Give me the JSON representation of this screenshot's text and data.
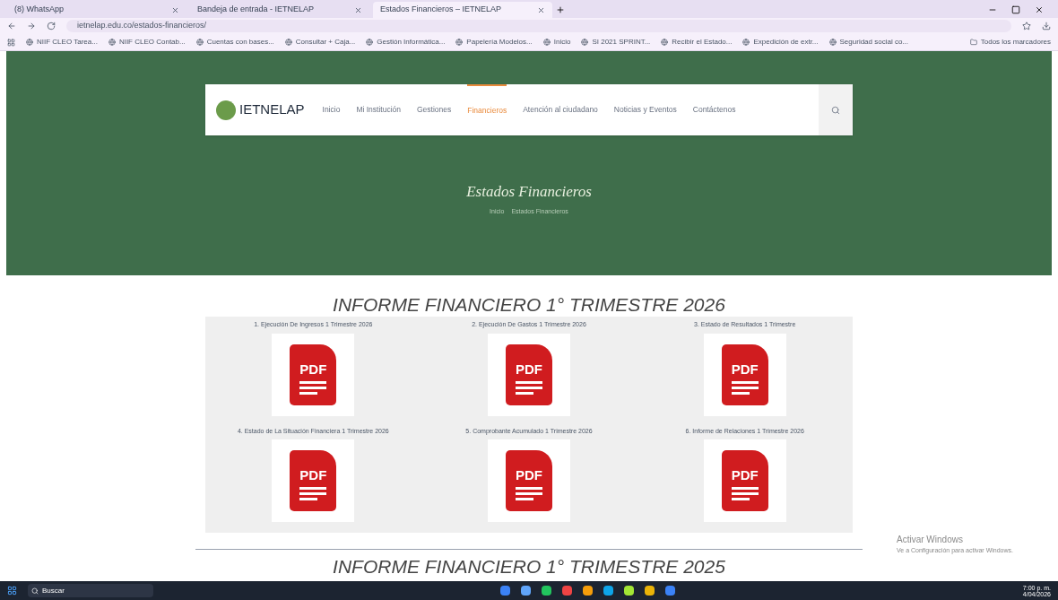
{
  "browser": {
    "tabs": [
      {
        "title": "(8) WhatsApp",
        "selected": false
      },
      {
        "title": "Bandeja de entrada - IETNELAP",
        "selected": false
      },
      {
        "title": "Estados Financieros – IETNELAP",
        "selected": true
      }
    ],
    "url": "ietnelap.edu.co/estados-financieros/",
    "bookmarks": [
      "NIIF CLEO Tarea...",
      "NIIF CLEO Contab...",
      "Cuentas con bases...",
      "Consultar + Caja...",
      "Gestión Informática...",
      "Papelería Modelos...",
      "Inicio",
      "SI 2021 SPRINT...",
      "Recibir el Estado...",
      "Expedición de extr...",
      "Seguridad social co..."
    ],
    "all_bookmarks": "Todos los marcadores"
  },
  "site": {
    "logo": "IETNELAP",
    "nav": [
      {
        "label": "Inicio",
        "selected": false
      },
      {
        "label": "Mi Institución",
        "selected": false
      },
      {
        "label": "Gestiones",
        "selected": false
      },
      {
        "label": "Financieros",
        "selected": true
      },
      {
        "label": "Atención al ciudadano",
        "selected": false
      },
      {
        "label": "Noticias y Eventos",
        "selected": false
      },
      {
        "label": "Contáctenos",
        "selected": false
      }
    ],
    "hero": {
      "title": "Estados Financieros",
      "breadcrumb": [
        "Inicio",
        "Estados Financieros"
      ]
    },
    "sections": [
      {
        "heading": "INFORME FINANCIERO 1° TRIMESTRE 2026",
        "documents": [
          {
            "title": "1. Ejecución De Ingresos 1 Trimestre 2026",
            "badge": "PDF"
          },
          {
            "title": "2. Ejecución De Gastos 1 Trimestre 2026",
            "badge": "PDF"
          },
          {
            "title": "3. Estado de Resultados 1 Trimestre",
            "badge": "PDF"
          },
          {
            "title": "4. Estado de La Situación Financiera 1 Trimestre 2026",
            "badge": "PDF"
          },
          {
            "title": "5. Comprobante Acumulado 1 Trimestre 2026",
            "badge": "PDF"
          },
          {
            "title": "6. Informe de Relaciones 1 Trimestre 2026",
            "badge": "PDF"
          }
        ]
      },
      {
        "heading": "INFORME FINANCIERO 1° TRIMESTRE 2025"
      }
    ]
  },
  "activation": {
    "title": "Activar Windows",
    "text": "Ve a Configuración para activar Windows."
  },
  "taskbar": {
    "search": "Buscar",
    "time": "7:00 p. m.",
    "date": "4/04/2026"
  }
}
